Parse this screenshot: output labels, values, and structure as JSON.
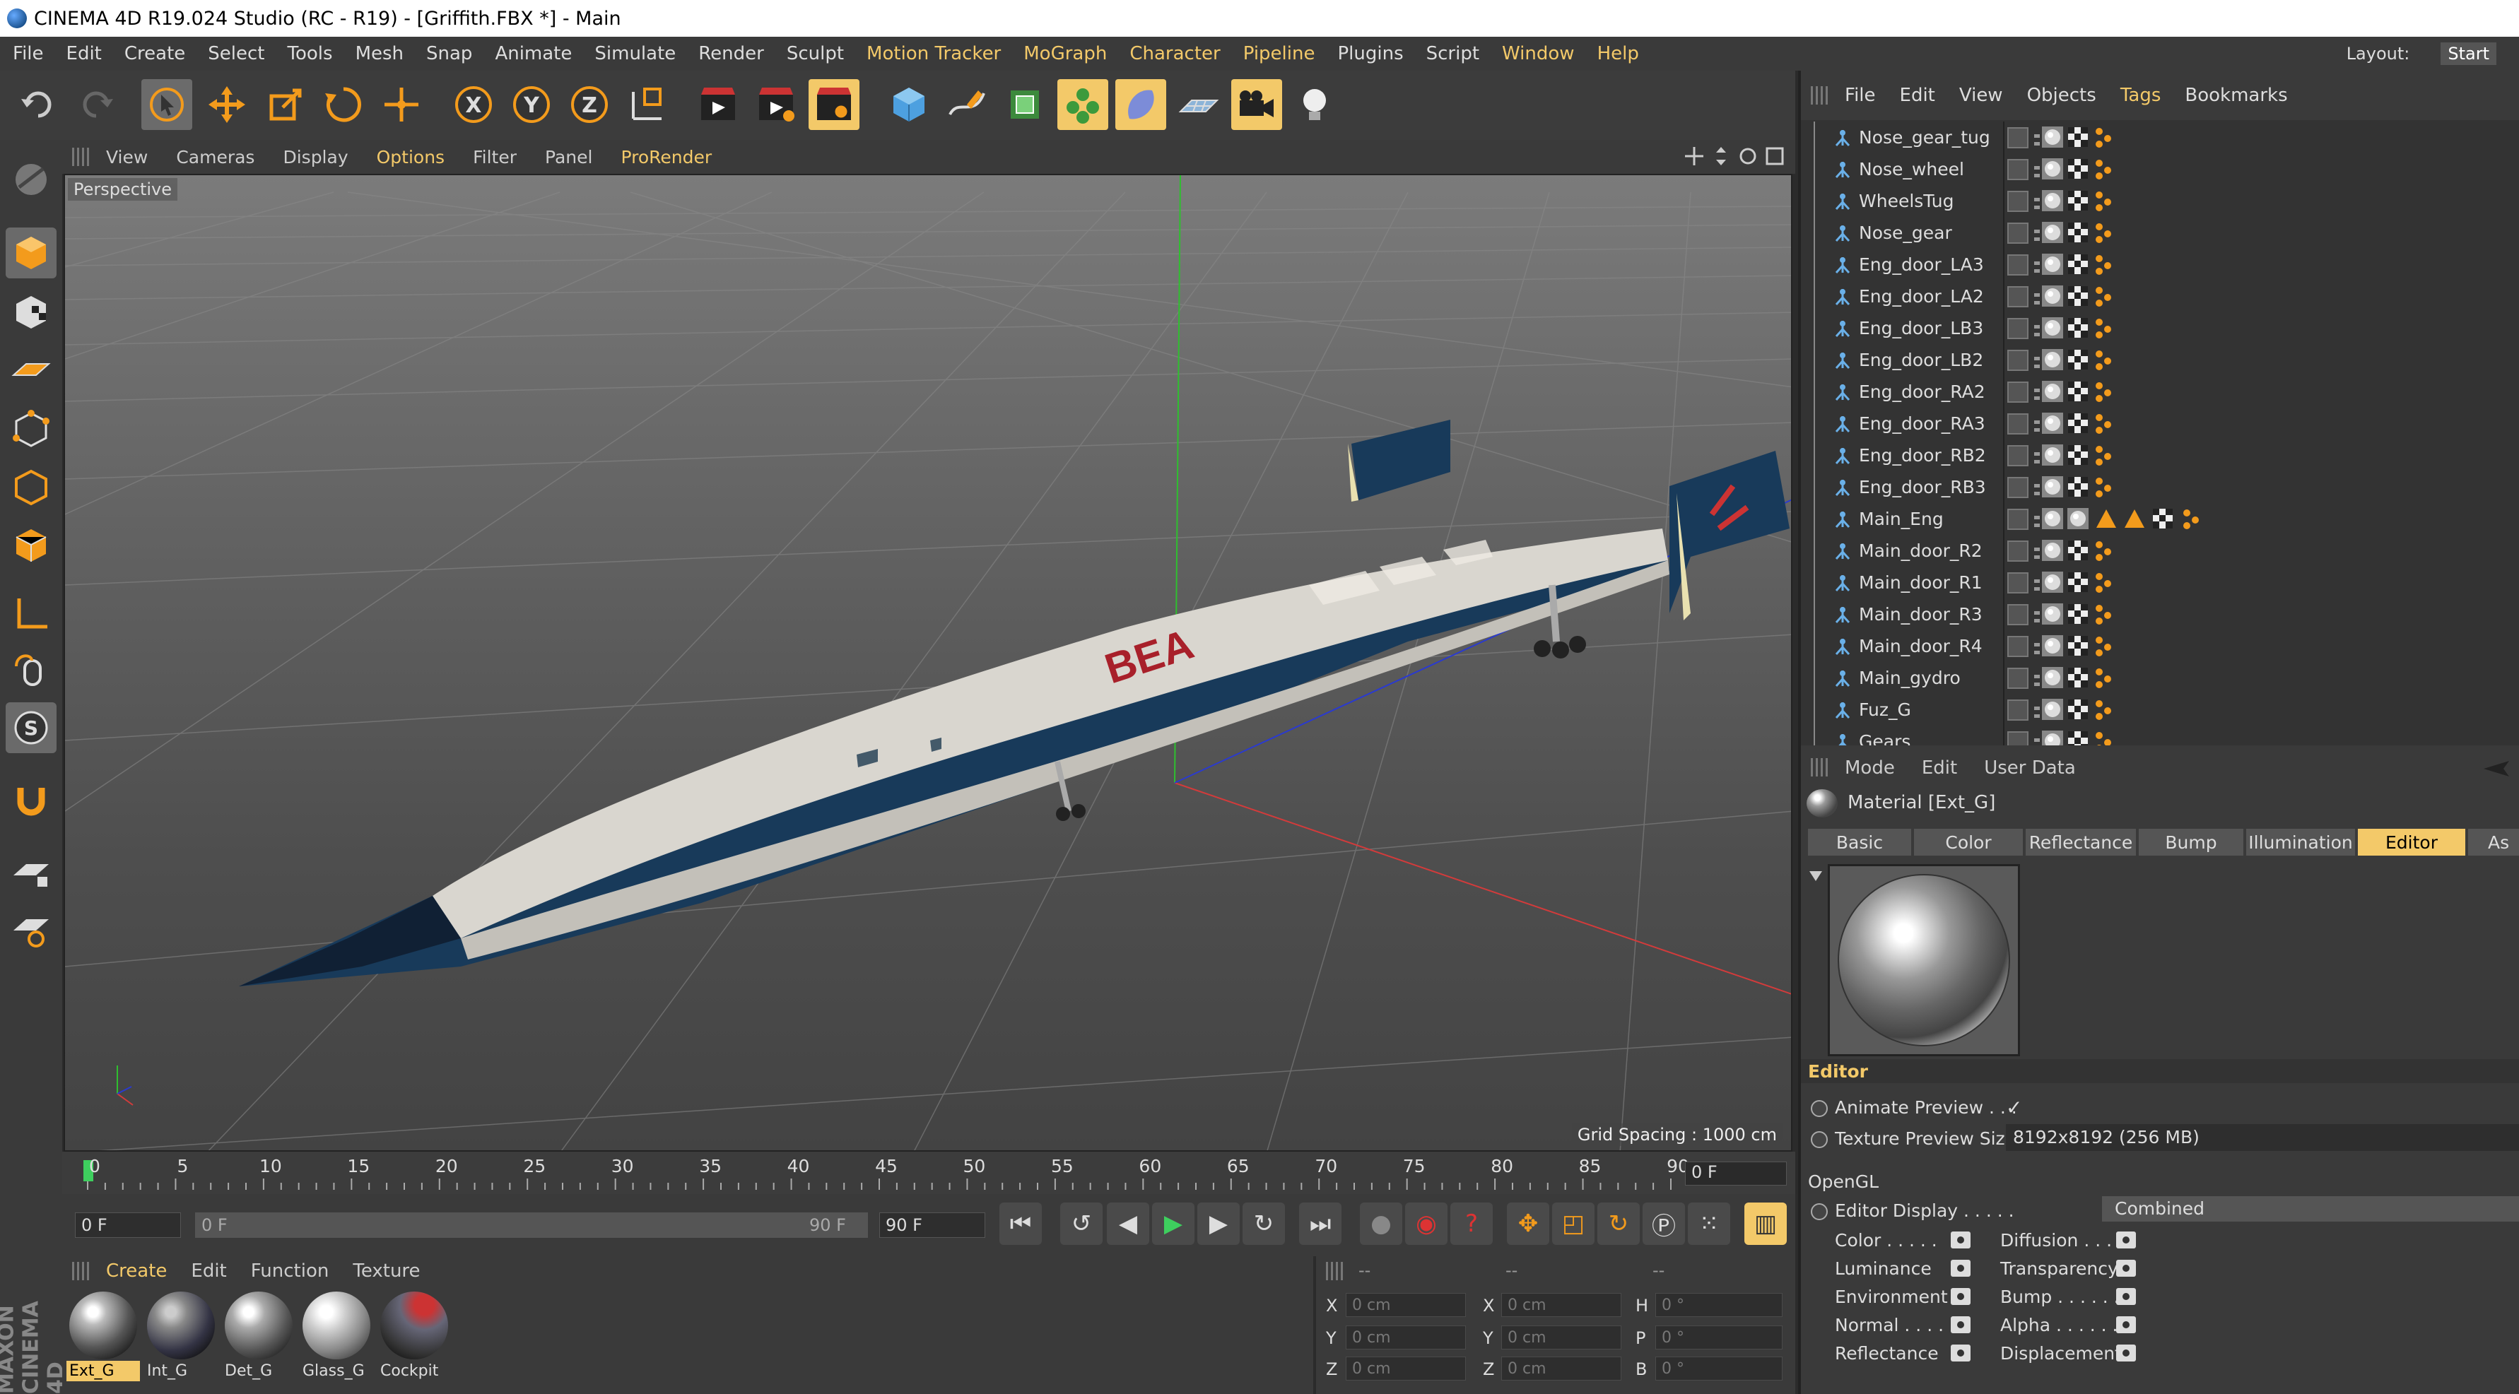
{
  "window": {
    "title": "CINEMA 4D R19.024 Studio (RC - R19) - [Griffith.FBX *] - Main"
  },
  "menubar": {
    "items": [
      "File",
      "Edit",
      "Create",
      "Select",
      "Tools",
      "Mesh",
      "Snap",
      "Animate",
      "Simulate",
      "Render",
      "Sculpt",
      "Motion Tracker",
      "MoGraph",
      "Character",
      "Pipeline",
      "Plugins",
      "Script",
      "Window",
      "Help"
    ],
    "layout_label": "Layout:",
    "layout_value": "Start"
  },
  "viewport": {
    "menu": [
      "View",
      "Cameras",
      "Display",
      "Options",
      "Filter",
      "Panel",
      "ProRender"
    ],
    "camera_label": "Perspective",
    "grid_spacing": "Grid Spacing : 1000 cm",
    "livery_text": "BEA",
    "colors": {
      "fuselage_top": "#d9d6cf",
      "fuselage_belly": "#183a5a",
      "x_axis": "#d23b3b",
      "y_axis": "#2fbf2f",
      "z_axis": "#2a3ad0"
    }
  },
  "timeline": {
    "ticks": [
      "0",
      "5",
      "10",
      "15",
      "20",
      "25",
      "30",
      "35",
      "40",
      "45",
      "50",
      "55",
      "60",
      "65",
      "70",
      "75",
      "80",
      "85",
      "90"
    ],
    "current_frame": "0 F"
  },
  "transport": {
    "start_field": "0 F",
    "slider_start": "0 F",
    "slider_end": "90 F",
    "end_field": "90 F"
  },
  "material_manager": {
    "menu": [
      "Create",
      "Edit",
      "Function",
      "Texture"
    ],
    "materials": [
      "Ext_G",
      "Int_G",
      "Det_G",
      "Glass_G",
      "Cockpit"
    ],
    "selected": "Ext_G"
  },
  "coordinates": {
    "headers": [
      "--",
      "--",
      "--"
    ],
    "rows": [
      {
        "a": "X",
        "av": "0 cm",
        "b": "X",
        "bv": "0 cm",
        "c": "H",
        "cv": "0 °"
      },
      {
        "a": "Y",
        "av": "0 cm",
        "b": "Y",
        "bv": "0 cm",
        "c": "P",
        "cv": "0 °"
      },
      {
        "a": "Z",
        "av": "0 cm",
        "b": "Z",
        "bv": "0 cm",
        "c": "B",
        "cv": "0 °"
      }
    ]
  },
  "object_manager": {
    "menu": [
      "File",
      "Edit",
      "View",
      "Objects",
      "Tags",
      "Bookmarks"
    ],
    "objects": [
      "Nose_gear_tug",
      "Nose_wheel",
      "WheelsTug",
      "Nose_gear",
      "Eng_door_LA3",
      "Eng_door_LA2",
      "Eng_door_LB3",
      "Eng_door_LB2",
      "Eng_door_RA2",
      "Eng_door_RA3",
      "Eng_door_RB2",
      "Eng_door_RB3",
      "Main_Eng",
      "Main_door_R2",
      "Main_door_R1",
      "Main_door_R3",
      "Main_door_R4",
      "Main_gydro",
      "Fuz_G",
      "Gears"
    ]
  },
  "attributes": {
    "menu": [
      "Mode",
      "Edit",
      "User Data"
    ],
    "title": "Material [Ext_G]",
    "tabs": [
      "Basic",
      "Color",
      "Reflectance",
      "Bump",
      "Illumination",
      "Editor",
      "As"
    ],
    "active_tab": "Editor",
    "section_editor": "Editor",
    "animate_preview_label": "Animate Preview . . .",
    "animate_preview_check": "✓",
    "texture_preview_label": "Texture Preview Size",
    "texture_preview_value": "8192x8192 (256 MB)",
    "section_opengl": "OpenGL",
    "editor_display_label": "Editor Display . . . . .",
    "editor_display_value": "Combined",
    "channels_left": [
      "Color . . . . .",
      "Luminance",
      "Environment",
      "Normal . . . .",
      "Reflectance"
    ],
    "channels_right": [
      "Diffusion . . .",
      "Transparency",
      "Bump . . . . . .",
      "Alpha . . . . . .",
      "Displacement"
    ]
  }
}
